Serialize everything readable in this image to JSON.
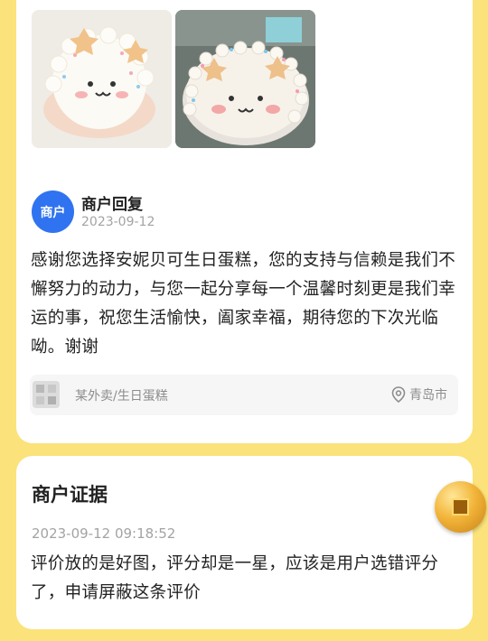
{
  "review": {
    "photos": [
      "cake-photo-1",
      "cake-photo-2"
    ]
  },
  "reply": {
    "avatar_label": "商户",
    "merchant_label": "商户回复",
    "date": "2023-09-12",
    "text": "感谢您选择安妮贝可生日蛋糕，您的支持与信赖是我们不懈努力的动力，与您一起分享每一个温馨时刻更是我们幸运的事，祝您生活愉快，阖家幸福，期待您的下次光临呦。谢谢"
  },
  "shop": {
    "name": "某外卖/生日蛋糕",
    "location": "青岛市",
    "location_icon": "location-pin-icon"
  },
  "evidence": {
    "title": "商户证据",
    "timestamp": "2023-09-12 09:18:52",
    "text": "评价放的是好图，评分却是一星，应该是用户选错评分了，申请屏蔽这条评价"
  },
  "floating": {
    "icon": "gold-coin-icon"
  },
  "colors": {
    "background": "#FBE27A",
    "card": "#FFFFFF",
    "avatar": "#2F73F0"
  }
}
